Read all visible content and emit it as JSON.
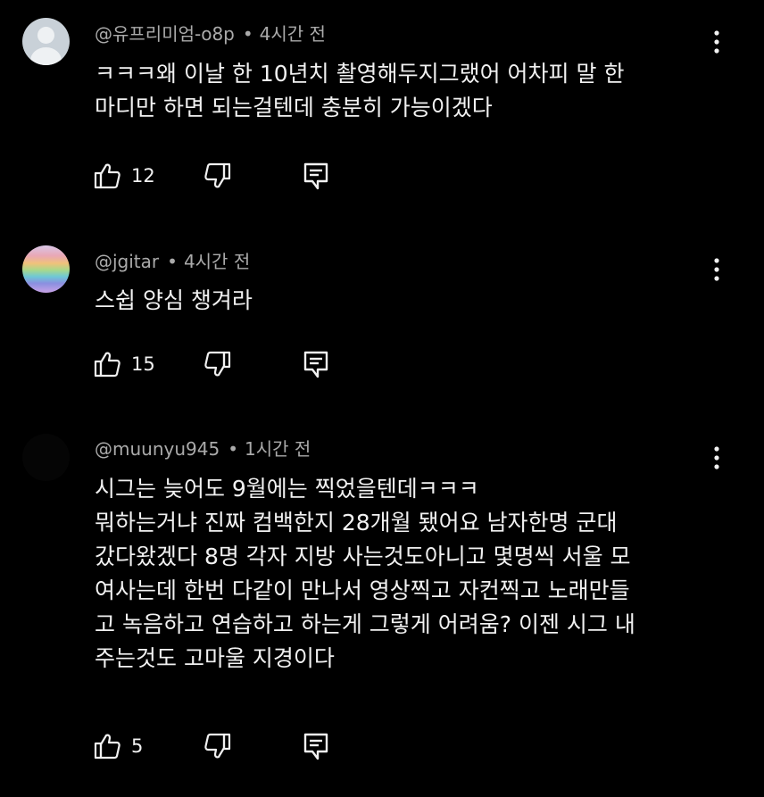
{
  "comments": [
    {
      "author": "@유프리미엄-o8p",
      "time": "4시간 전",
      "avatar": "default-person-avatar",
      "lines": [
        "ㅋㅋㅋ왜 이날 한 10년치 촬영해두지그랬어 어차피 말 한",
        "마디만 하면 되는걸텐데 충분히 가능이겠다"
      ],
      "likes": "12"
    },
    {
      "author": "@jgitar",
      "time": "4시간 전",
      "avatar": "gradient-avatar",
      "lines": [
        "스쉽 양심 챙겨라"
      ],
      "likes": "15"
    },
    {
      "author": "@muunyu945",
      "time": "1시간 전",
      "avatar": "dark-avatar",
      "lines": [
        "시그는 늦어도 9월에는 찍었을텐데ㅋㅋㅋ",
        "뭐하는거냐 진짜 컴백한지 28개월 됐어요 남자한명 군대",
        "갔다왔겠다 8명 각자 지방 사는것도아니고 몇명씩 서울 모",
        "여사는데 한번 다같이 만나서 영상찍고 자컨찍고 노래만들",
        "고 녹음하고 연습하고 하는게 그렇게 어려움? 이젠 시그 내",
        "주는것도 고마울 지경이다"
      ],
      "likes": "5"
    }
  ],
  "icons": {
    "like": "thumbs-up-icon",
    "dislike": "thumbs-down-icon",
    "reply": "reply-icon",
    "more": "more-vertical-icon"
  },
  "colors": {
    "background": "#000000",
    "text": "#f1f1f1",
    "meta": "#aaaaaa"
  }
}
